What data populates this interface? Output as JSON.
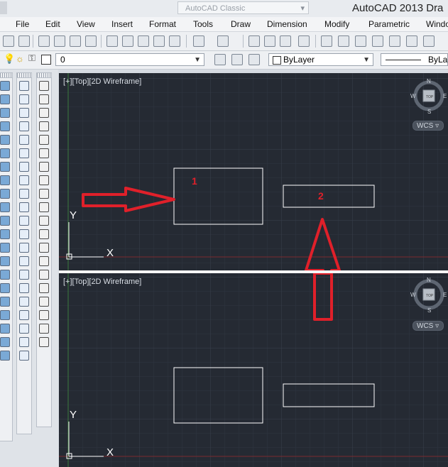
{
  "window": {
    "workspace_label": "AutoCAD Classic",
    "app_title": "AutoCAD 2013    Dra"
  },
  "menu": [
    "File",
    "Edit",
    "View",
    "Insert",
    "Format",
    "Tools",
    "Draw",
    "Dimension",
    "Modify",
    "Parametric",
    "Windo"
  ],
  "layer_toolbar": {
    "layer_value": "0",
    "color_value": "ByLayer",
    "linetype_value": "ByLayer"
  },
  "viewports": [
    {
      "label": "[+][Top][2D Wireframe]",
      "wcs": "WCS",
      "compass": {
        "n": "N",
        "s": "S",
        "e": "E",
        "w": "W",
        "top": "TOP"
      },
      "ucs": {
        "x": "X",
        "y": "Y"
      },
      "annotations": [
        "1",
        "2"
      ]
    },
    {
      "label": "[+][Top][2D Wireframe]",
      "wcs": "WCS",
      "compass": {
        "n": "N",
        "s": "S",
        "e": "E",
        "w": "W",
        "top": "TOP"
      },
      "ucs": {
        "x": "X",
        "y": "Y"
      }
    }
  ],
  "colors": {
    "canvas": "#252a33",
    "geometry": "#ffffff",
    "markup_red": "#e0202a",
    "grid": "#2e343e"
  }
}
